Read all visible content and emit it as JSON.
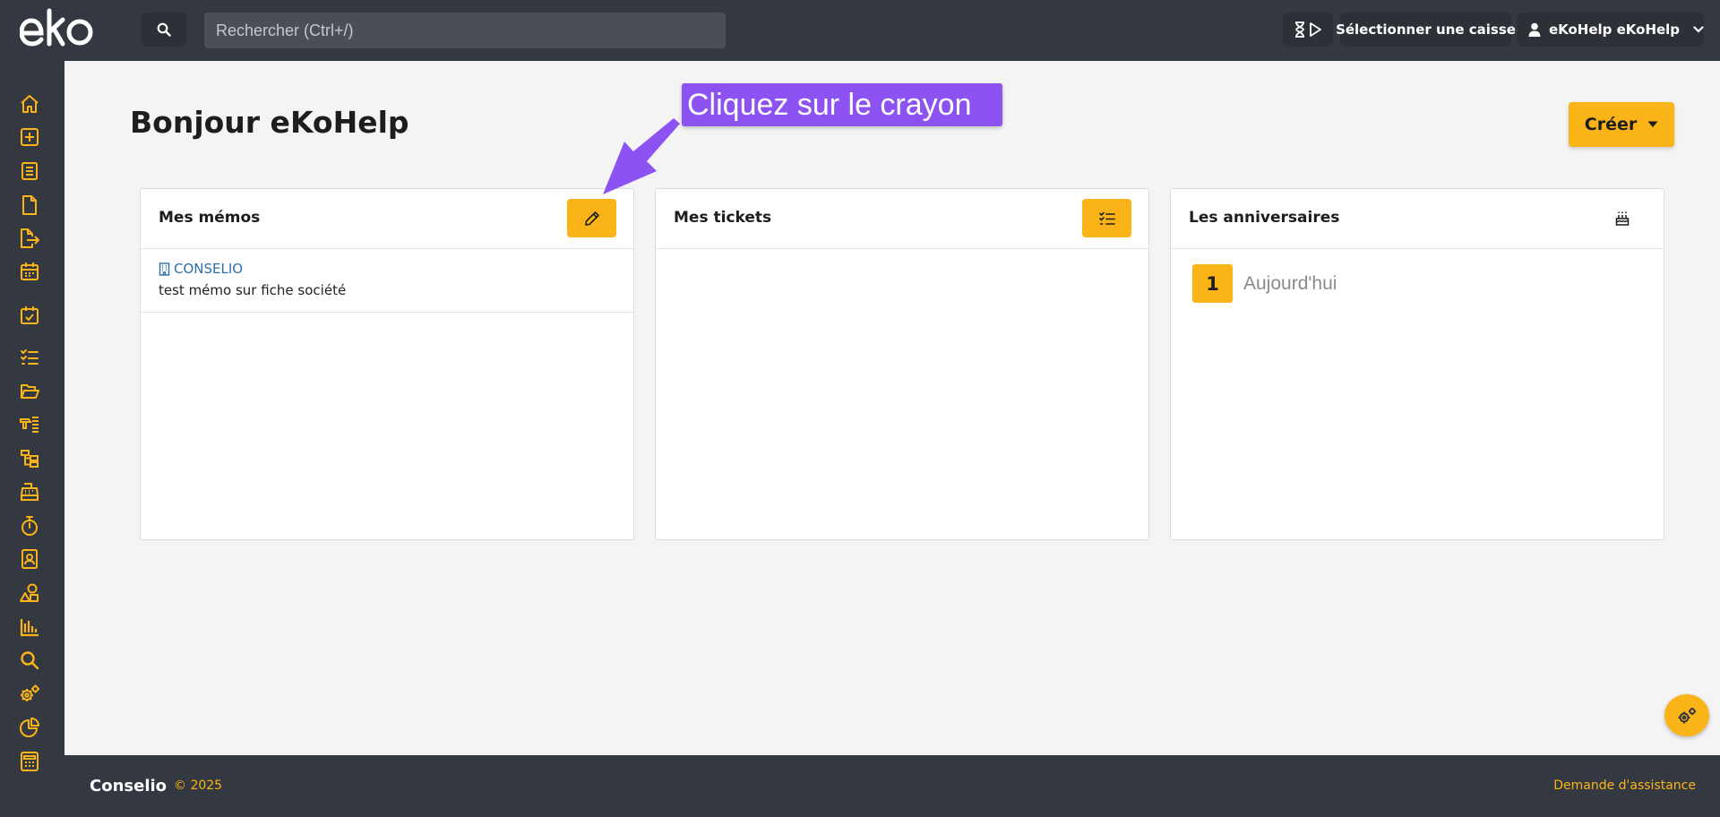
{
  "app": {
    "logo_text": "eKo",
    "accent_color": "#fbb417",
    "dark_color": "#343840"
  },
  "topbar": {
    "search_icon": "search-icon",
    "search_placeholder": "Rechercher (Ctrl+/)",
    "timer_icons": [
      "hourglass-icon",
      "play-icon"
    ],
    "caisse_label": "Sélectionner une caisse",
    "user_label": "eKoHelp eKoHelp"
  },
  "sidebar": {
    "items": [
      "home-icon",
      "add-square-icon",
      "list-document-icon",
      "file-icon",
      "file-export-icon",
      "calendar-icon",
      "calendar-check-icon",
      "task-list-icon",
      "folder-open-icon",
      "tools-list-icon",
      "hierarchy-icon",
      "cash-register-icon",
      "stopwatch-icon",
      "contact-card-icon",
      "shapes-icon",
      "bar-chart-icon",
      "search-icon",
      "gears-icon",
      "pie-chart-icon",
      "calculator-icon"
    ]
  },
  "main": {
    "greeting": "Bonjour eKoHelp",
    "create_label": "Créer"
  },
  "cards": {
    "memos": {
      "title": "Mes mémos",
      "action_icon": "pencil-icon",
      "items": [
        {
          "company": "CONSELIO",
          "text": "test mémo sur fiche société"
        }
      ]
    },
    "tickets": {
      "title": "Mes tickets",
      "action_icon": "checklist-icon"
    },
    "anniversaries": {
      "title": "Les anniversaires",
      "action_icon": "birthday-cake-icon",
      "count": "1",
      "label": "Aujourd'hui"
    }
  },
  "tutorial": {
    "callout_text": "Cliquez sur le crayon",
    "callout_color": "#8c52f2"
  },
  "footer": {
    "brand": "Conselio",
    "copyright": "© 2025",
    "help_link": "Demande d'assistance"
  }
}
